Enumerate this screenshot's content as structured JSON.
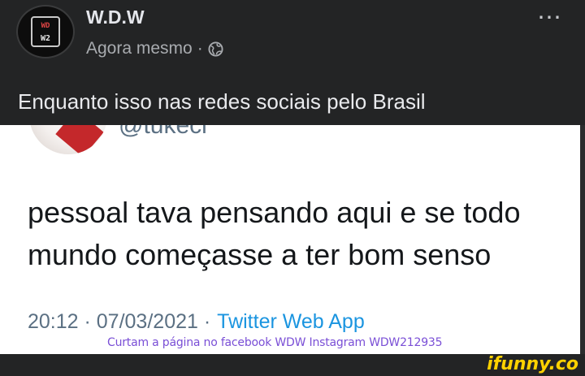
{
  "header": {
    "page_name": "W.D.W",
    "timestamp": "Agora mesmo",
    "separator": "·",
    "privacy_icon": "globe-icon",
    "more_icon": "⋯",
    "avatar_text_top": "WD",
    "avatar_text_bottom": "W2"
  },
  "post": {
    "caption": "Enquanto isso nas redes sociais pelo Brasil"
  },
  "tweet": {
    "handle": "@tukeci",
    "text": "pessoal tava pensando aqui e se todo mundo começasse a ter bom senso",
    "time_date": "20:12 · 07/03/2021 ·",
    "source": "Twitter Web App",
    "watermark": "Curtam a página no facebook WDW Instagram WDW212935"
  },
  "footer": {
    "ifunny_logo": "ifunny.co"
  },
  "colors": {
    "dark_bg": "#232425",
    "twitter_blue": "#1b95e0",
    "ifunny_yellow": "#ffd200",
    "watermark_purple": "#7a4fd6"
  }
}
